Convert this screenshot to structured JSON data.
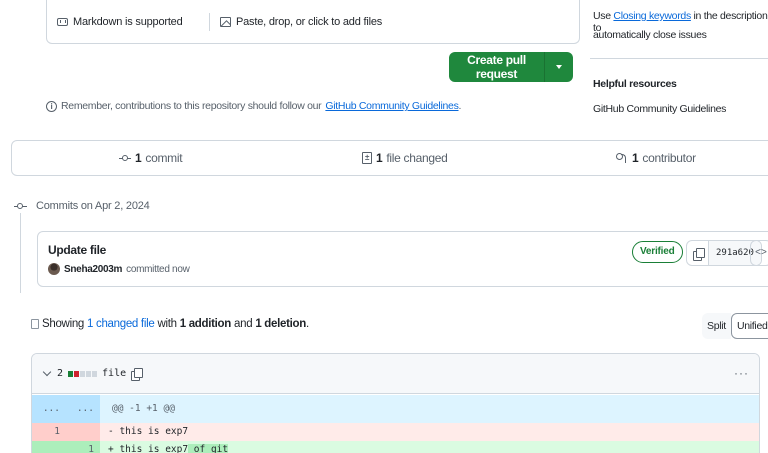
{
  "composer": {
    "markdown_label": "Markdown is supported",
    "attach_label": "Paste, drop, or click to add files"
  },
  "create_pr": {
    "label": "Create pull request"
  },
  "guidelines_note": {
    "prefix": "Remember, contributions to this repository should follow our",
    "link": "GitHub Community Guidelines",
    "suffix": "."
  },
  "sidebar": {
    "keywords_prefix": "Use",
    "keywords_link": "Closing keywords",
    "keywords_suffix": "in the description to",
    "keywords_line2": "automatically close issues",
    "helpful_heading": "Helpful resources",
    "helpful_link": "GitHub Community Guidelines"
  },
  "stats": {
    "commits_count": "1",
    "commits_label": "commit",
    "files_count": "1",
    "files_label": "file changed",
    "contributors_count": "1",
    "contributors_label": "contributor"
  },
  "timeline": {
    "heading": "Commits on Apr 2, 2024"
  },
  "commit": {
    "title": "Update file",
    "author": "Sneha2003m",
    "action": "committed now",
    "verified": "Verified",
    "sha": "291a620",
    "browse_glyph": "<>"
  },
  "showing": {
    "prefix": "Showing",
    "changed_link": "1 changed file",
    "with": "with",
    "additions": "1 addition",
    "and": "and",
    "deletions": "1 deletion",
    "suffix": "."
  },
  "view_toggle": {
    "split": "Split",
    "unified": "Unified"
  },
  "file": {
    "changes": "2",
    "name": "file",
    "menu_glyph": "···",
    "diffstat_colors": [
      "#1a7f37",
      "#cf222e",
      "#d0d7de",
      "#d0d7de",
      "#d0d7de"
    ]
  },
  "diff": {
    "hunk_n1": "...",
    "hunk_n2": "...",
    "hunk": "@@ -1 +1 @@",
    "del_n1": "1",
    "del_code": "- this is exp7",
    "add_n2": "1",
    "add_code_base": "+ this is exp7",
    "add_code_hl": " of git"
  },
  "colors": {
    "primary_button": "#1f883d",
    "link": "#0969da",
    "addition_bg": "#dafbe1",
    "deletion_bg": "#ffebe9",
    "hunk_bg": "#ddf4ff"
  }
}
